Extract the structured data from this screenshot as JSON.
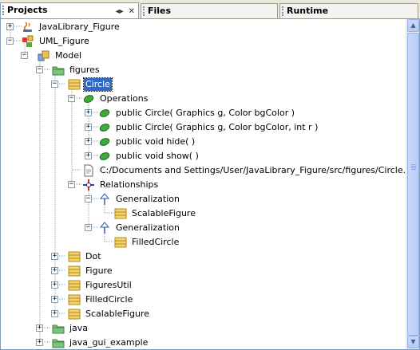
{
  "tabs": [
    {
      "label": "Projects",
      "active": true
    },
    {
      "label": "Files",
      "active": false
    },
    {
      "label": "Runtime",
      "active": false
    }
  ],
  "tab_controls": {
    "minimize": "◂▸",
    "close": "✕"
  },
  "tree": [
    {
      "label": "JavaLibrary_Figure",
      "icon": "java-project-icon",
      "expander": "+"
    },
    {
      "label": "UML_Figure",
      "icon": "uml-project-icon",
      "expander": "−"
    },
    {
      "label": "Model",
      "icon": "model-icon",
      "expander": "−"
    },
    {
      "label": "figures",
      "icon": "package-icon",
      "expander": "−"
    },
    {
      "label": "Circle",
      "icon": "class-icon",
      "expander": "−",
      "selected": true
    },
    {
      "label": "Operations",
      "icon": "operations-icon",
      "expander": "−"
    },
    {
      "label": "public Circle( Graphics g, Color bgColor )",
      "icon": "operation-icon",
      "expander": "+"
    },
    {
      "label": "public Circle( Graphics g, Color bgColor, int r )",
      "icon": "operation-icon",
      "expander": "+"
    },
    {
      "label": "public void  hide(  )",
      "icon": "operation-icon",
      "expander": "+"
    },
    {
      "label": "public void  show(  )",
      "icon": "operation-icon",
      "expander": "+"
    },
    {
      "label": "C:/Documents and Settings/User/JavaLibrary_Figure/src/figures/Circle.java",
      "icon": "file-icon",
      "expander": ""
    },
    {
      "label": "Relationships",
      "icon": "relationships-icon",
      "expander": "−"
    },
    {
      "label": "Generalization",
      "icon": "generalization-icon",
      "expander": "−"
    },
    {
      "label": "ScalableFigure",
      "icon": "class-icon",
      "expander": ""
    },
    {
      "label": "Generalization",
      "icon": "generalization-icon",
      "expander": "−"
    },
    {
      "label": "FilledCircle",
      "icon": "class-icon",
      "expander": ""
    },
    {
      "label": "Dot",
      "icon": "class-icon",
      "expander": "+"
    },
    {
      "label": "Figure",
      "icon": "class-icon",
      "expander": "+"
    },
    {
      "label": "FiguresUtil",
      "icon": "class-icon",
      "expander": "+"
    },
    {
      "label": "FilledCircle",
      "icon": "class-icon",
      "expander": "+"
    },
    {
      "label": "ScalableFigure",
      "icon": "class-icon",
      "expander": "+"
    },
    {
      "label": "java",
      "icon": "package-icon",
      "expander": "+"
    },
    {
      "label": "java_gui_example",
      "icon": "package-icon",
      "expander": "+"
    }
  ],
  "colors": {
    "selection": "#316ac5",
    "tree_line": "#a0a0a0",
    "class": "#f0c040",
    "package": "#5aa55a"
  }
}
